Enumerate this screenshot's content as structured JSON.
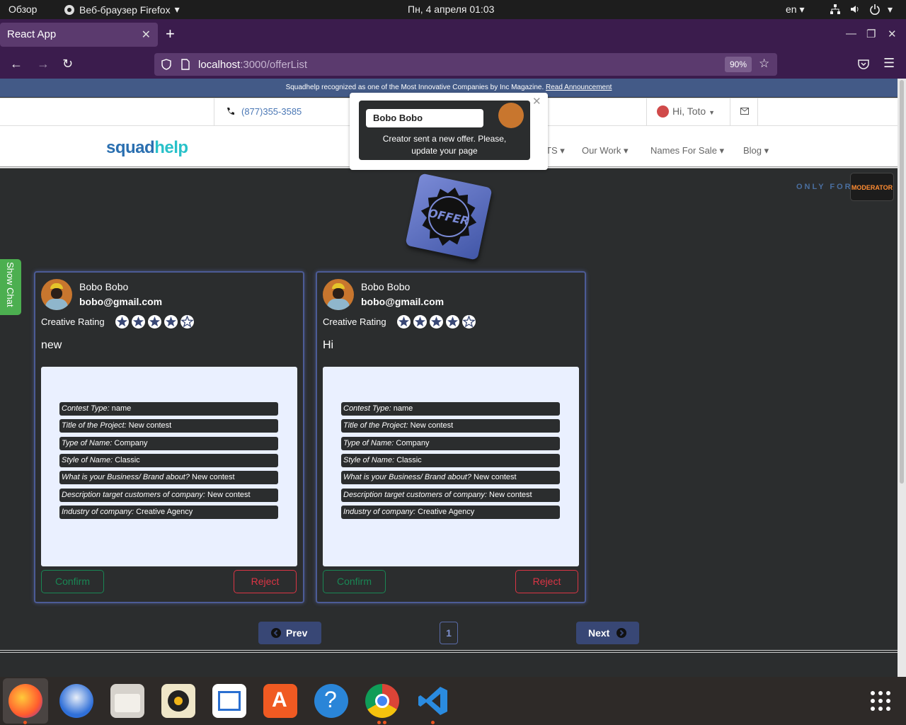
{
  "top_bar": {
    "overview": "Обзор",
    "app_name": "Веб-браузер Firefox",
    "clock": "Пн, 4 апреля  01:03",
    "lang": "en"
  },
  "browser": {
    "tab_title": "React App",
    "url_host": "localhost",
    "url_path": ":3000/offerList",
    "zoom": "90%"
  },
  "site": {
    "announcement": "Squadhelp recognized as one of the Most Innovative Companies by Inc Magazine.",
    "announcement_link": "Read Announcement",
    "phone": "(877)355-3585",
    "greeting": "Hi, Toto",
    "logo_squad": "squad",
    "logo_help": "help",
    "menu": [
      "TS",
      "Our Work",
      "Names For Sale",
      "Blog"
    ],
    "only_for": "ONLY FOR",
    "moderator_badge": "MODERATOR",
    "offer_badge": "OFFER",
    "show_chat": "Show Chat"
  },
  "notification": {
    "name": "Bobo Bobo",
    "message_line1": "Creator sent a new offer. Please,",
    "message_line2": "update your page"
  },
  "offers": [
    {
      "name": "Bobo Bobo",
      "email": "bobo@gmail.com",
      "rating_label": "Creative Rating",
      "rating": 4,
      "message": "new",
      "details": [
        {
          "label": "Contest Type:",
          "value": "name"
        },
        {
          "label": "Title of the Project:",
          "value": "New contest"
        },
        {
          "label": "Type of Name:",
          "value": "Company"
        },
        {
          "label": "Style of Name:",
          "value": "Classic"
        },
        {
          "label": "What is your Business/ Brand about?",
          "value": "New contest"
        },
        {
          "label": "Description target customers of company:",
          "value": "New contest"
        },
        {
          "label": "Industry of company:",
          "value": "Creative Agency"
        }
      ],
      "confirm": "Confirm",
      "reject": "Reject"
    },
    {
      "name": "Bobo Bobo",
      "email": "bobo@gmail.com",
      "rating_label": "Creative Rating",
      "rating": 4,
      "message": "Hi",
      "details": [
        {
          "label": "Contest Type:",
          "value": "name"
        },
        {
          "label": "Title of the Project:",
          "value": "New contest"
        },
        {
          "label": "Type of Name:",
          "value": "Company"
        },
        {
          "label": "Style of Name:",
          "value": "Classic"
        },
        {
          "label": "What is your Business/ Brand about?",
          "value": "New contest"
        },
        {
          "label": "Description target customers of company:",
          "value": "New contest"
        },
        {
          "label": "Industry of company:",
          "value": "Creative Agency"
        }
      ],
      "confirm": "Confirm",
      "reject": "Reject"
    }
  ],
  "pagination": {
    "prev": "Prev",
    "page": "1",
    "next": "Next"
  },
  "colors": {
    "page_bg": "#2b2d2e",
    "accent_blue": "#384775",
    "confirm_green": "#198754",
    "reject_red": "#dc3545",
    "chat_green": "#4caf50"
  }
}
